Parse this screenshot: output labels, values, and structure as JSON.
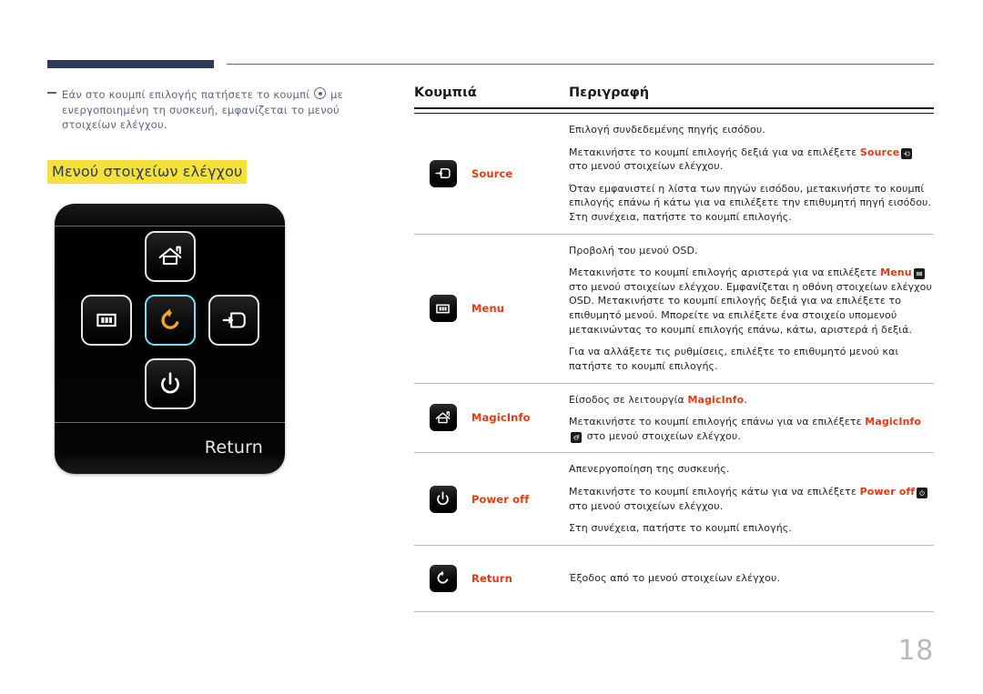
{
  "page": {
    "number": "18",
    "accent_navy": "#2d3a57",
    "accent_red": "#e8380d",
    "highlight_yellow": "#f5e03c"
  },
  "note": {
    "text_before_icon": "Εάν στο κουμπί επιλογής πατήσετε το κουμπί ",
    "icon": "select-button-icon",
    "text_after_icon": " με ενεργοποιημένη τη συσκευή, εμφανίζεται το μενού στοιχείων ελέγχου."
  },
  "section": {
    "heading": "Μενού στοιχείων ελέγχου"
  },
  "osd": {
    "return_label": "Return",
    "keys": [
      {
        "position": "up",
        "icon": "magicinfo-home-icon",
        "selected": false
      },
      {
        "position": "left",
        "icon": "menu-icon",
        "selected": false
      },
      {
        "position": "center",
        "icon": "return-icon",
        "selected": true
      },
      {
        "position": "right",
        "icon": "source-icon",
        "selected": false
      },
      {
        "position": "down",
        "icon": "power-off-icon",
        "selected": false
      }
    ]
  },
  "table": {
    "headers": {
      "buttons": "Κουμπιά",
      "description": "Περιγραφή"
    },
    "rows": [
      {
        "icon": "source-icon",
        "label": "Source",
        "paragraphs": [
          {
            "parts": [
              {
                "t": "Επιλογή συνδεδεμένης πηγής εισόδου."
              }
            ]
          },
          {
            "parts": [
              {
                "t": "Μετακινήστε το κουμπί επιλογής δεξιά για να επιλέξετε "
              },
              {
                "t": "Source",
                "hl": true
              },
              {
                "icon": "source-icon"
              },
              {
                "t": " στο μενού στοιχείων ελέγχου."
              }
            ]
          },
          {
            "parts": [
              {
                "t": "Όταν εμφανιστεί η λίστα των πηγών εισόδου, μετακινήστε το κουμπί επιλογής επάνω ή κάτω για να επιλέξετε την επιθυμητή πηγή εισόδου. Στη συνέχεια, πατήστε το κουμπί επιλογής."
              }
            ]
          }
        ]
      },
      {
        "icon": "menu-icon",
        "label": "Menu",
        "paragraphs": [
          {
            "parts": [
              {
                "t": "Προβολή του μενού OSD."
              }
            ]
          },
          {
            "parts": [
              {
                "t": "Μετακινήστε το κουμπί επιλογής αριστερά για να επιλέξετε "
              },
              {
                "t": "Menu",
                "hl": true
              },
              {
                "icon": "menu-icon"
              },
              {
                "t": " στο μενού στοιχείων ελέγχου. Εμφανίζεται η οθόνη στοιχείων ελέγχου OSD. Μετακινήστε το κουμπί επιλογής δεξιά για να επιλέξετε το επιθυμητό μενού. Μπορείτε να επιλέξετε ένα στοιχείο υπομενού μετακινώντας το κουμπί επιλογής επάνω, κάτω, αριστερά ή δεξιά."
              }
            ]
          },
          {
            "parts": [
              {
                "t": "Για να αλλάξετε τις ρυθμίσεις, επιλέξτε το επιθυμητό μενού και πατήστε το κουμπί επιλογής."
              }
            ]
          }
        ]
      },
      {
        "icon": "magicinfo-home-icon",
        "label": "MagicInfo",
        "paragraphs": [
          {
            "parts": [
              {
                "t": "Είσοδος σε λειτουργία "
              },
              {
                "t": "MagicInfo",
                "hl": true
              },
              {
                "t": "."
              }
            ]
          },
          {
            "parts": [
              {
                "t": "Μετακινήστε το κουμπί επιλογής επάνω για να επιλέξετε "
              },
              {
                "t": "MagicInfo",
                "hl": true
              },
              {
                "icon": "magicinfo-home-icon"
              },
              {
                "t": " στο μενού στοιχείων ελέγχου."
              }
            ]
          }
        ]
      },
      {
        "icon": "power-off-icon",
        "label": "Power off",
        "paragraphs": [
          {
            "parts": [
              {
                "t": "Απενεργοποίηση της συσκευής."
              }
            ]
          },
          {
            "parts": [
              {
                "t": "Μετακινήστε το κουμπί επιλογής κάτω για να επιλέξετε "
              },
              {
                "t": "Power off",
                "hl": true
              },
              {
                "icon": "power-off-icon"
              },
              {
                "t": " στο μενού στοιχείων ελέγχου."
              }
            ]
          },
          {
            "parts": [
              {
                "t": "Στη συνέχεια, πατήστε το κουμπί επιλογής."
              }
            ]
          }
        ]
      },
      {
        "icon": "return-icon",
        "label": "Return",
        "paragraphs": [
          {
            "parts": [
              {
                "t": "Έξοδος από το μενού στοιχείων ελέγχου."
              }
            ]
          }
        ]
      }
    ]
  }
}
